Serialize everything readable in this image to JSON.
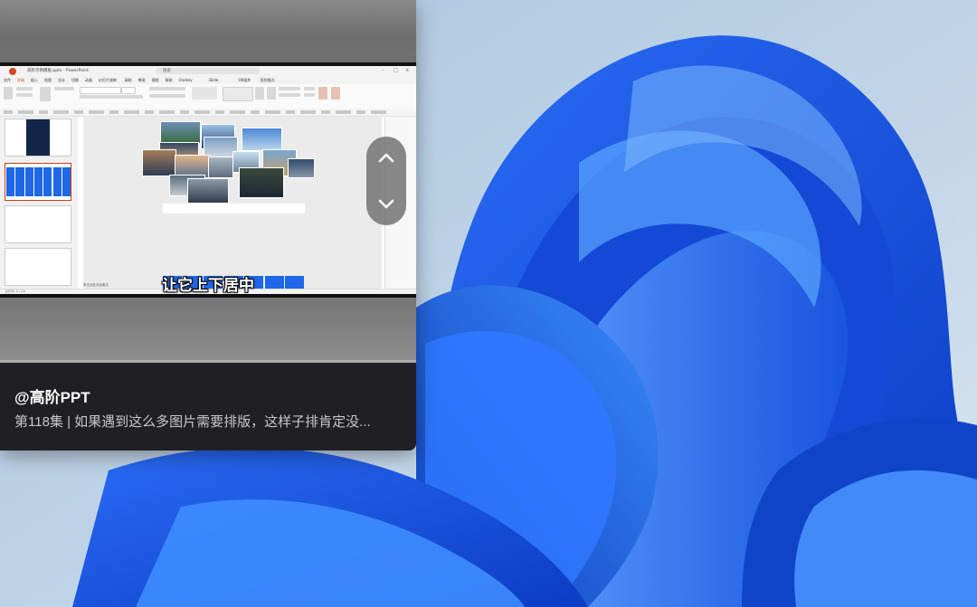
{
  "video_card": {
    "author": "@高阶PPT",
    "episode": "第118集 | 如果遇到这么多图片需要排版，这样子排肯定没...",
    "subtitle": "让它上下居中"
  },
  "ppt_window": {
    "title": "高阶示例模板.pptx - PowerPoint",
    "search_placeholder": "搜索",
    "tabs": [
      "文件",
      "开始",
      "插入",
      "绘图",
      "设计",
      "切换",
      "动画",
      "幻灯片放映",
      "录制",
      "审阅",
      "视图",
      "帮助",
      "Onekey",
      "iSlide",
      "OK插件",
      "形状格式"
    ],
    "active_tab": "开始",
    "status_left": "幻灯片 2 / 24",
    "status_notes": "单击此处添加备注"
  },
  "colors": {
    "slide_blue": "#1e67e6",
    "accent_red": "#c43e1c",
    "footer_bg": "#202024"
  },
  "icons": {
    "scroll_up": "chevron-up-icon",
    "scroll_down": "chevron-down-icon"
  }
}
